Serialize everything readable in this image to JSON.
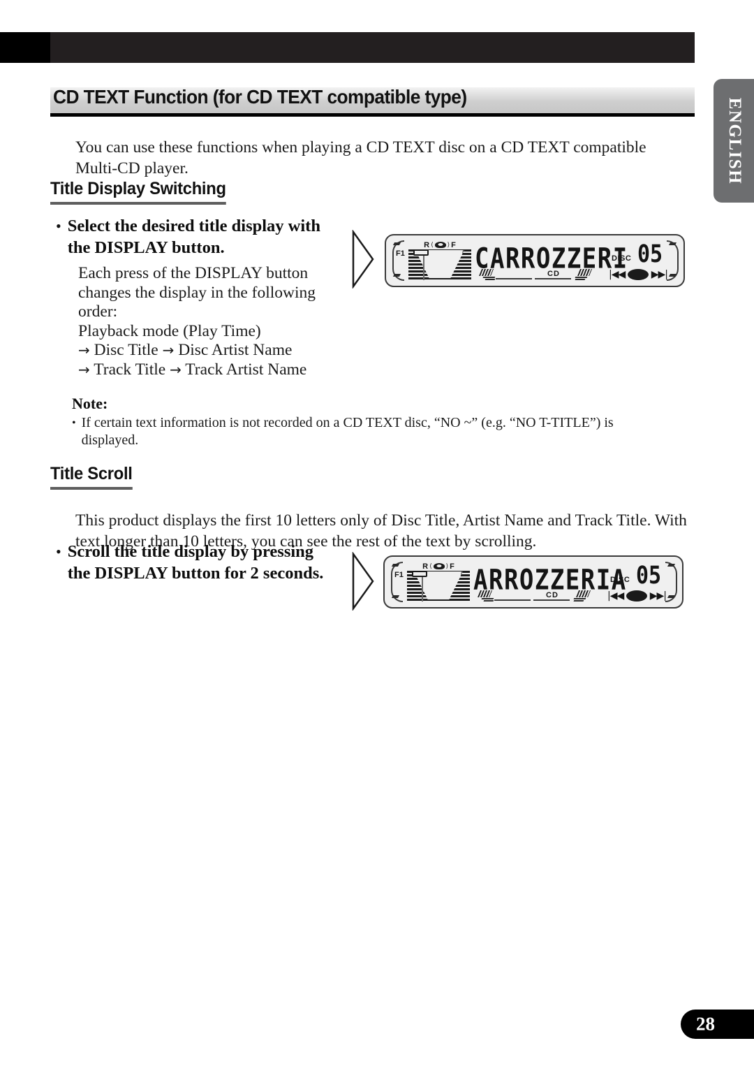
{
  "header": {
    "language_tab": "ENGLISH"
  },
  "page_title": "CD TEXT Function (for CD TEXT compatible type)",
  "intro": "You can use these functions when playing a CD TEXT disc on a CD TEXT compatible Multi-CD player.",
  "sections": [
    {
      "heading": "Title Display Switching",
      "bullet": "Select the desired title display with the DISPLAY button.",
      "detail_lines": [
        "Each press of the DISPLAY button changes the display in the following order:",
        "Playback mode (Play Time)",
        "Disc Title",
        "Disc Artist Name",
        "Track Title",
        "Track Artist Name"
      ],
      "arrow": "→"
    },
    {
      "heading": "Title Scroll",
      "paragraph": "This product displays the first 10 letters only of Disc Title, Artist Name and Track Title. With text longer than 10 letters, you can see the rest of the text by scrolling.",
      "bullet": "Scroll the title display by pressing the DISPLAY button for 2 seconds."
    }
  ],
  "note": {
    "label": "Note:",
    "items": [
      "If certain text information is not recorded on a CD TEXT disc, “NO ~” (e.g. “NO T-TITLE”) is displayed."
    ],
    "bullet_char": "•"
  },
  "lcd_displays": [
    {
      "main_text": "CARROZZERI",
      "disc_label": "DISC",
      "disc_number": "05",
      "media_label": "CD",
      "fader_front": "F",
      "fader_rear": "R",
      "preset_label": "F1",
      "seek_back": "⏪",
      "seek_forward": "⏩"
    },
    {
      "main_text": "ARROZZERIA",
      "disc_label": "DISC",
      "disc_number": "05",
      "media_label": "CD",
      "fader_front": "F",
      "fader_rear": "R",
      "preset_label": "F1",
      "seek_back": "⏪",
      "seek_forward": "⏩"
    }
  ],
  "footer": {
    "page_number": "28"
  },
  "colors": {
    "header_black": "#000000",
    "header_dark": "#231f20",
    "lang_tab_gray": "#6d6e70",
    "title_band_gray": "#cfcfcf",
    "rule_black": "#000000",
    "section_rule_gray": "#5e5e5e",
    "lcd_bg": "#f0f0f0",
    "lcd_ink": "#141414"
  }
}
